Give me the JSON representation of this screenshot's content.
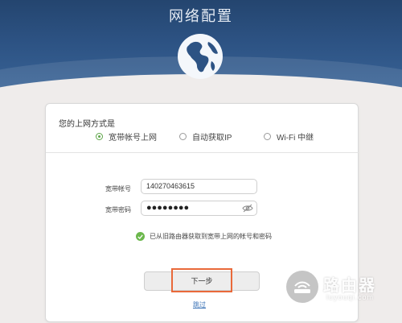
{
  "header": {
    "title": "网络配置",
    "icon": "globe-icon",
    "bg_color": "#2d5384"
  },
  "connection": {
    "section_label": "您的上网方式是",
    "options": [
      {
        "label": "宽带帐号上网",
        "checked": true
      },
      {
        "label": "自动获取IP",
        "checked": false
      },
      {
        "label": "Wi-Fi 中继",
        "checked": false
      }
    ]
  },
  "form": {
    "account_label": "宽带帐号",
    "account_value": "140270463615",
    "password_label": "宽带密码",
    "password_masked": "●●●●●●●●",
    "eye_icon": "eye-slash-icon"
  },
  "status": {
    "message": "已从旧路由器获取到宽带上网的帐号和密码",
    "icon": "check-circle-icon",
    "color": "#6cb84d"
  },
  "actions": {
    "next_label": "下一步",
    "skip_label": "跳过",
    "highlight_color": "#e9693a"
  },
  "watermark": {
    "text": "路由器",
    "subtext": "luyouqi.com"
  }
}
